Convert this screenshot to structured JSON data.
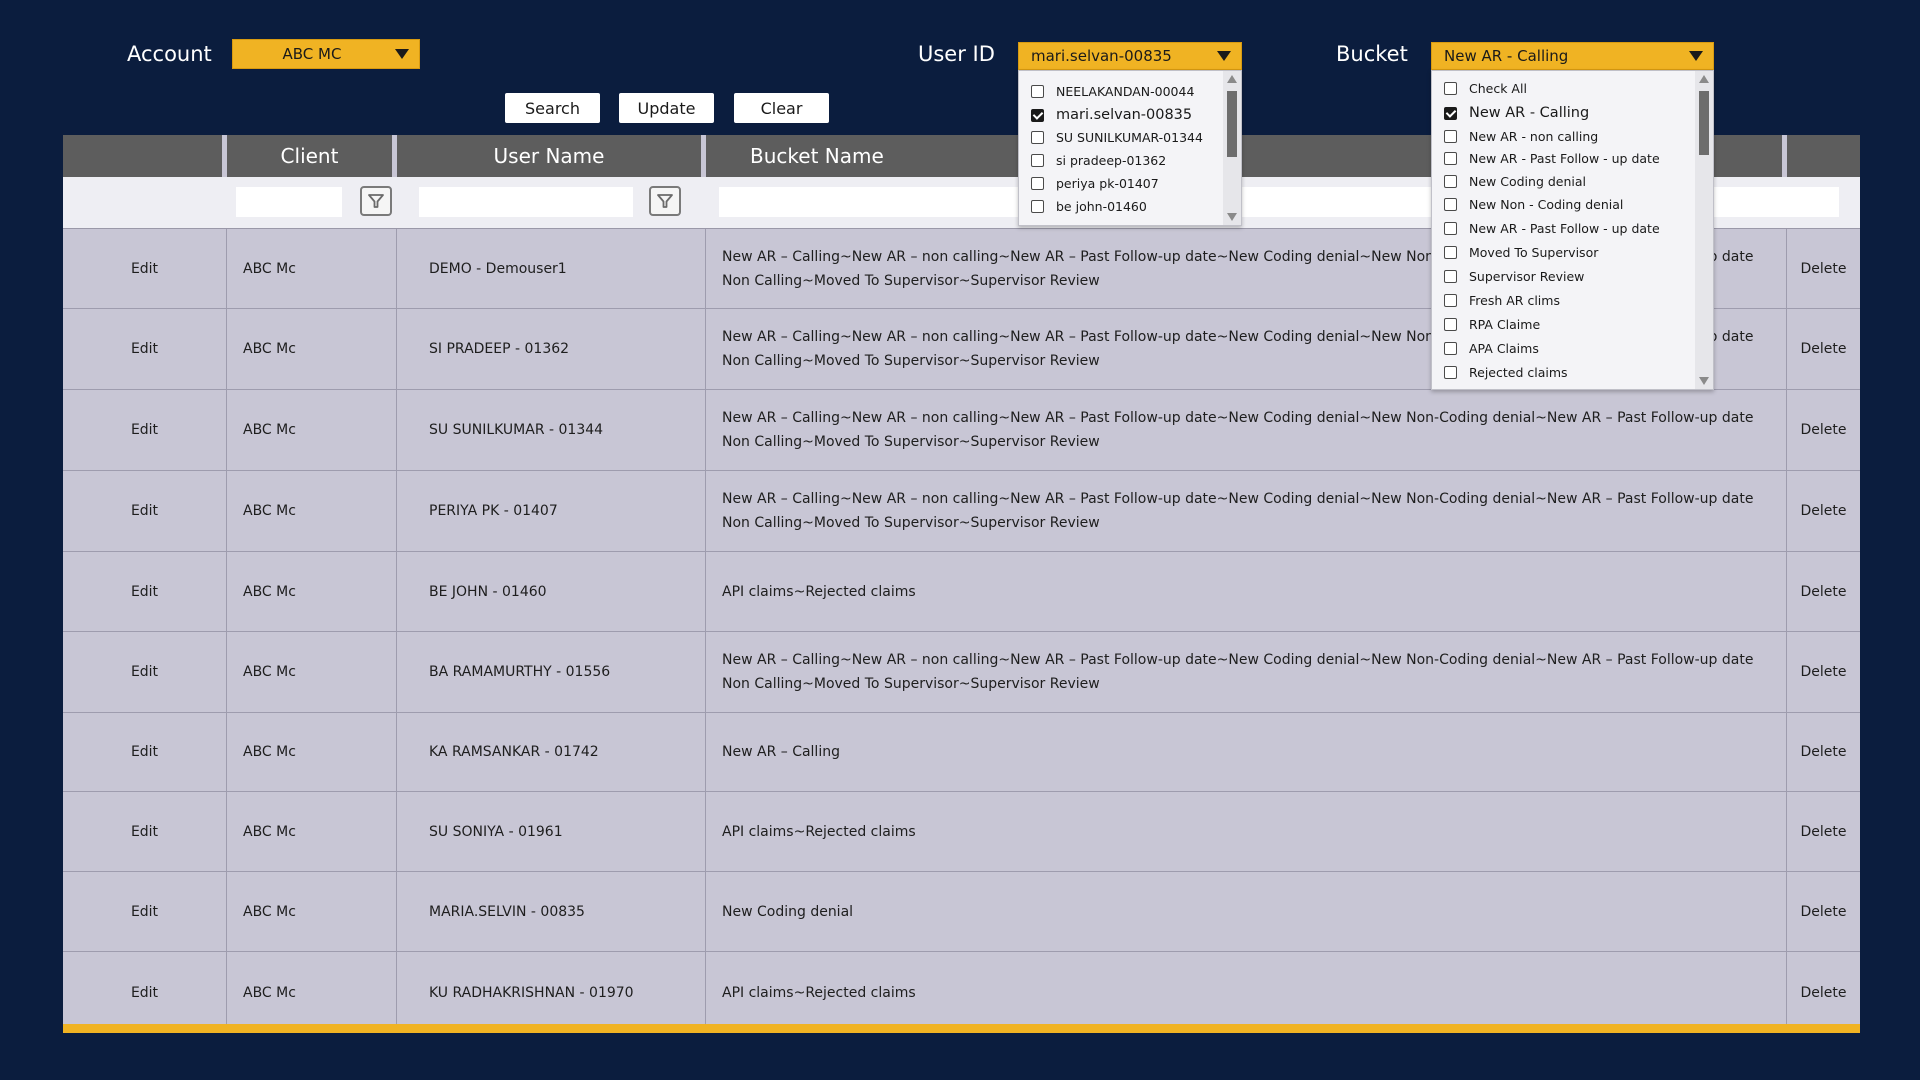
{
  "header": {
    "account_label": "Account",
    "account_value": "ABC MC",
    "userid_label": "User ID",
    "userid_value": "mari.selvan-00835",
    "bucket_label": "Bucket",
    "bucket_value": "New AR - Calling"
  },
  "toolbar": {
    "search_label": "Search",
    "update_label": "Update",
    "clear_label": "Clear"
  },
  "table": {
    "columns": [
      "",
      "Client",
      "User Name",
      "Bucket Name",
      ""
    ],
    "rows": [
      {
        "edit": "Edit",
        "client": "ABC Mc",
        "user": "DEMO - Demouser1",
        "bucket": "New AR – Calling~New AR – non calling~New AR – Past Follow-up date~New Coding denial~New Non-Coding denial~New AR – Past Follow-up date Non Calling~Moved To Supervisor~Supervisor Review",
        "del": "Delete"
      },
      {
        "edit": "Edit",
        "client": "ABC Mc",
        "user": "SI PRADEEP - 01362",
        "bucket": "New AR – Calling~New AR – non calling~New AR – Past Follow-up date~New Coding denial~New Non-Coding denial~New AR – Past Follow-up date Non Calling~Moved To Supervisor~Supervisor Review",
        "del": "Delete"
      },
      {
        "edit": "Edit",
        "client": "ABC Mc",
        "user": "SU SUNILKUMAR - 01344",
        "bucket": "New AR – Calling~New AR – non calling~New AR – Past Follow-up date~New Coding denial~New Non-Coding denial~New AR – Past Follow-up date Non Calling~Moved To Supervisor~Supervisor Review",
        "del": "Delete"
      },
      {
        "edit": "Edit",
        "client": "ABC Mc",
        "user": "PERIYA PK - 01407",
        "bucket": "New AR – Calling~New AR – non calling~New AR – Past Follow-up date~New Coding denial~New Non-Coding denial~New AR – Past Follow-up date Non Calling~Moved To Supervisor~Supervisor Review",
        "del": "Delete"
      },
      {
        "edit": "Edit",
        "client": "ABC Mc",
        "user": "BE JOHN - 01460",
        "bucket": "API claims~Rejected claims",
        "del": "Delete"
      },
      {
        "edit": "Edit",
        "client": "ABC Mc",
        "user": "BA RAMAMURTHY - 01556",
        "bucket": "New AR – Calling~New AR – non calling~New AR – Past Follow-up date~New Coding denial~New Non-Coding denial~New AR – Past Follow-up date Non Calling~Moved To Supervisor~Supervisor Review",
        "del": "Delete"
      },
      {
        "edit": "Edit",
        "client": "ABC Mc",
        "user": "KA RAMSANKAR - 01742",
        "bucket": "New AR – Calling",
        "del": "Delete"
      },
      {
        "edit": "Edit",
        "client": "ABC Mc",
        "user": "SU SONIYA - 01961",
        "bucket": "API claims~Rejected claims",
        "del": "Delete"
      },
      {
        "edit": "Edit",
        "client": "ABC Mc",
        "user": "MARIA.SELVIN - 00835",
        "bucket": "New Coding denial",
        "del": "Delete"
      },
      {
        "edit": "Edit",
        "client": "ABC Mc",
        "user": "KU RADHAKRISHNAN - 01970",
        "bucket": "API claims~Rejected claims",
        "del": "Delete"
      }
    ]
  },
  "userid_dropdown": {
    "items": [
      {
        "label": "NEELAKANDAN-00044",
        "checked": false
      },
      {
        "label": "mari.selvan-00835",
        "checked": true
      },
      {
        "label": "SU SUNILKUMAR-01344",
        "checked": false
      },
      {
        "label": "si pradeep-01362",
        "checked": false
      },
      {
        "label": "periya pk-01407",
        "checked": false
      },
      {
        "label": "be john-01460",
        "checked": false
      }
    ]
  },
  "bucket_dropdown": {
    "items": [
      {
        "label": "Check All",
        "checked": false
      },
      {
        "label": "New AR  - Calling",
        "checked": true
      },
      {
        "label": "New AR - non calling",
        "checked": false
      },
      {
        "label": "New AR - Past Follow - up date",
        "checked": false
      },
      {
        "label": "New Coding denial",
        "checked": false
      },
      {
        "label": "New Non - Coding denial",
        "checked": false
      },
      {
        "label": "New AR - Past Follow - up date",
        "checked": false
      },
      {
        "label": "Moved To Supervisor",
        "checked": false
      },
      {
        "label": "Supervisor Review",
        "checked": false
      },
      {
        "label": "Fresh AR clims",
        "checked": false
      },
      {
        "label": "RPA Claime",
        "checked": false
      },
      {
        "label": "APA Claims",
        "checked": false
      },
      {
        "label": "Rejected claims",
        "checked": false
      }
    ]
  },
  "colors": {
    "background": "#0b1d3e",
    "accent": "#f0b323",
    "header_gray": "#5d5d5d",
    "row_bg": "#c8c6d5"
  }
}
